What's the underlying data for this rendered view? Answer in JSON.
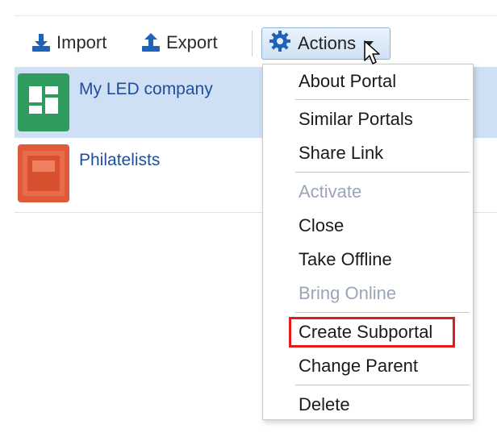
{
  "toolbar": {
    "import_label": "Import",
    "export_label": "Export",
    "actions_label": "Actions"
  },
  "portals": [
    {
      "name": "My LED company",
      "thumb": "green-grid-icon",
      "selected": true
    },
    {
      "name": "Philatelists",
      "thumb": "stamp-image",
      "selected": false
    }
  ],
  "menu": {
    "items": [
      {
        "label": "About Portal",
        "enabled": true
      },
      {
        "label": "Similar Portals",
        "enabled": true
      },
      {
        "label": "Share Link",
        "enabled": true
      },
      {
        "label": "Activate",
        "enabled": false
      },
      {
        "label": "Close",
        "enabled": true
      },
      {
        "label": "Take Offline",
        "enabled": true
      },
      {
        "label": "Bring Online",
        "enabled": false
      },
      {
        "label": "Create Subportal",
        "enabled": true,
        "highlighted": true
      },
      {
        "label": "Change Parent",
        "enabled": true
      },
      {
        "label": "Delete",
        "enabled": true
      }
    ]
  },
  "colors": {
    "link": "#1f4e9a",
    "selected_row": "#cfe0f4",
    "highlight": "#e01b1b",
    "disabled": "#9aa6b5"
  }
}
